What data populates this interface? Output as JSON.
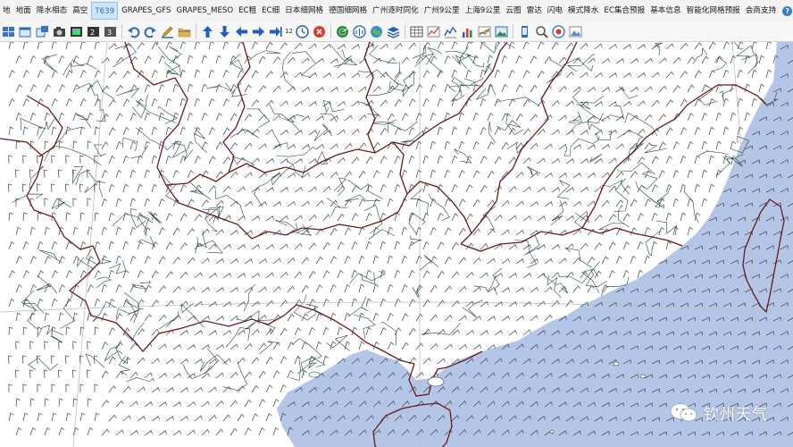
{
  "menu": [
    {
      "label": "地",
      "active": false
    },
    {
      "label": "地面",
      "active": false
    },
    {
      "label": "降水相态",
      "active": false
    },
    {
      "label": "高空",
      "active": false
    },
    {
      "label": "T639",
      "active": true
    },
    {
      "label": "GRAPES_GFS",
      "active": false
    },
    {
      "label": "GRAPES_MESO",
      "active": false
    },
    {
      "label": "EC粗",
      "active": false
    },
    {
      "label": "EC细",
      "active": false
    },
    {
      "label": "日本细网格",
      "active": false
    },
    {
      "label": "德国细网格",
      "active": false
    },
    {
      "label": "广州逐时同化",
      "active": false
    },
    {
      "label": "广州9公里",
      "active": false
    },
    {
      "label": "上海9公里",
      "active": false
    },
    {
      "label": "云图",
      "active": false
    },
    {
      "label": "雷达",
      "active": false
    },
    {
      "label": "闪电",
      "active": false
    },
    {
      "label": "模式降水",
      "active": false
    },
    {
      "label": "EC集合预报",
      "active": false
    },
    {
      "label": "基本信息",
      "active": false
    },
    {
      "label": "智能化网格预报",
      "active": false
    },
    {
      "label": "会商支持",
      "active": false
    }
  ],
  "help_symbol": "?",
  "toolbar": {
    "left_icons": [
      "layout-grid-icon",
      "window-icon",
      "zoom-window-icon",
      "camera-icon",
      "film-icon",
      "animation-icon",
      "snapshot-icon"
    ],
    "mid_icons": [
      "undo-icon",
      "redo-icon",
      "pen-icon",
      "folder-icon"
    ],
    "nav_icons": [
      "arrow-up-icon",
      "arrow-down-icon",
      "arrow-left-icon",
      "arrow-right-icon",
      "end-icon"
    ],
    "hour_value": "12",
    "right_icons": [
      "clock-icon",
      "stop-icon",
      "radar-globe-icon",
      "signal-icon",
      "earth-icon",
      "layers-icon",
      "table-icon",
      "line-chart-icon",
      "trend-icon",
      "bar-chart-icon",
      "pie-chart-icon",
      "image-icon",
      "phone-icon",
      "search-icon",
      "export-icon",
      "mountain-icon"
    ]
  },
  "colors": {
    "land": "#ffffff",
    "sea": "#b3c6e8",
    "province_border": "#6a1a1a",
    "county_border": "#1f4a3f",
    "wind_barb": "#555555",
    "accent": "#2d7fd6"
  },
  "watermark": {
    "text": "钦州天气"
  }
}
